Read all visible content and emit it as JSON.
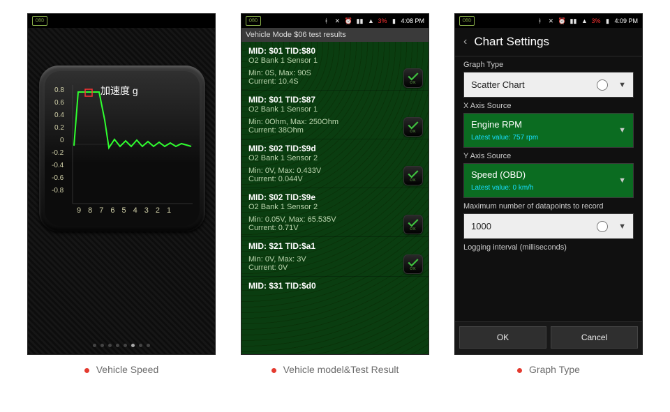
{
  "captions": [
    "Vehicle Speed",
    "Vehicle model&Test Result",
    "Graph Type"
  ],
  "status": {
    "time_a": "4:08 PM",
    "time_b": "4:09 PM",
    "batt": "3%"
  },
  "phone1": {
    "title": "加速度 g",
    "y_labels": [
      "0.8",
      "0.6",
      "0.4",
      "0.2",
      "0",
      "-0.2",
      "-0.4",
      "-0.6",
      "-0.8"
    ],
    "x_labels": [
      "9",
      "8",
      "7",
      "6",
      "5",
      "4",
      "3",
      "2",
      "1"
    ],
    "pager_count": 8,
    "pager_active": 5,
    "chart_data": {
      "type": "line",
      "title": "加速度 g",
      "xlabel": "",
      "ylabel": "",
      "ylim": [
        -0.9,
        0.9
      ],
      "x": [
        9.5,
        9.2,
        9.0,
        8.6,
        8.2,
        7.5,
        7.0,
        6.5,
        6.0,
        5.5,
        5.0,
        4.5,
        4.0,
        3.5,
        3.0,
        2.5,
        2.0,
        1.5,
        1.0,
        0.5
      ],
      "values": [
        -0.02,
        0.8,
        0.8,
        0.8,
        0.55,
        0.0,
        0.08,
        0.0,
        0.05,
        0.0,
        0.06,
        0.0,
        0.04,
        0.0,
        0.05,
        0.0,
        0.04,
        0.0,
        0.03,
        0.0
      ]
    }
  },
  "phone2": {
    "title": "Vehicle Mode $06 test results",
    "items": [
      {
        "mid": "MID: $01 TID:$80",
        "sub": "O2 Bank 1 Sensor 1",
        "stats": "Min: 0S, Max: 90S",
        "current": "Current: 10.4S"
      },
      {
        "mid": "MID: $01 TID:$87",
        "sub": "O2 Bank 1 Sensor 1",
        "stats": "Min: 0Ohm, Max: 250Ohm",
        "current": "Current: 38Ohm"
      },
      {
        "mid": "MID: $02 TID:$9d",
        "sub": "O2 Bank 1 Sensor 2",
        "stats": "Min: 0V, Max: 0.433V",
        "current": "Current: 0.044V"
      },
      {
        "mid": "MID: $02 TID:$9e",
        "sub": "O2 Bank 1 Sensor 2",
        "stats": "Min: 0.05V, Max: 65.535V",
        "current": "Current: 0.71V"
      },
      {
        "mid": "MID: $21 TID:$a1",
        "sub": "",
        "stats": "Min: 0V, Max: 3V",
        "current": "Current: 0V"
      },
      {
        "mid": "MID: $31 TID:$d0",
        "sub": "",
        "stats": "",
        "current": ""
      }
    ],
    "ok_label": "OK"
  },
  "phone3": {
    "title": "Chart Settings",
    "sections": {
      "graph_type": {
        "label": "Graph Type",
        "value": "Scatter Chart"
      },
      "x_axis": {
        "label": "X Axis Source",
        "value": "Engine RPM",
        "latest": "Latest value: 757 rpm"
      },
      "y_axis": {
        "label": "Y Axis Source",
        "value": "Speed (OBD)",
        "latest": "Latest value: 0 km/h"
      },
      "max_dp": {
        "label": "Maximum number of datapoints to record",
        "value": "1000"
      },
      "log_int": {
        "label": "Logging interval (milliseconds)"
      }
    },
    "buttons": {
      "ok": "OK",
      "cancel": "Cancel"
    }
  }
}
